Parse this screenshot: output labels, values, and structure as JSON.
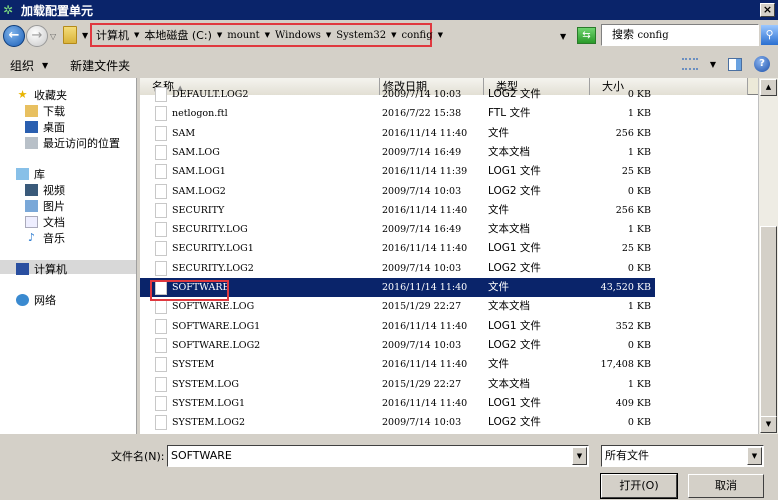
{
  "window": {
    "title": "加载配置单元",
    "close_label": "×"
  },
  "navigation": {
    "breadcrumbs": [
      "计算机",
      "本地磁盘 (C:)",
      "mount",
      "Windows",
      "System32",
      "config"
    ],
    "search_placeholder_prefix": "搜索",
    "search_scope": "config"
  },
  "toolbar": {
    "organize": "组织",
    "new_folder": "新建文件夹"
  },
  "sidebar": {
    "favorites": {
      "label": "收藏夹",
      "items": [
        "下载",
        "桌面",
        "最近访问的位置"
      ]
    },
    "libraries": {
      "label": "库",
      "items": [
        "视频",
        "图片",
        "文档",
        "音乐"
      ]
    },
    "computer": "计算机",
    "network": "网络"
  },
  "columns": {
    "name": "名称",
    "date": "修改日期",
    "type": "类型",
    "size": "大小"
  },
  "files": [
    {
      "name": "DEFAULT.LOG2",
      "date": "2009/7/14 10:03",
      "type": "LOG2 文件",
      "size": "0 KB"
    },
    {
      "name": "netlogon.ftl",
      "date": "2016/7/22 15:38",
      "type": "FTL 文件",
      "size": "1 KB"
    },
    {
      "name": "SAM",
      "date": "2016/11/14 11:40",
      "type": "文件",
      "size": "256 KB"
    },
    {
      "name": "SAM.LOG",
      "date": "2009/7/14 16:49",
      "type": "文本文档",
      "size": "1 KB"
    },
    {
      "name": "SAM.LOG1",
      "date": "2016/11/14 11:39",
      "type": "LOG1 文件",
      "size": "25 KB"
    },
    {
      "name": "SAM.LOG2",
      "date": "2009/7/14 10:03",
      "type": "LOG2 文件",
      "size": "0 KB"
    },
    {
      "name": "SECURITY",
      "date": "2016/11/14 11:40",
      "type": "文件",
      "size": "256 KB"
    },
    {
      "name": "SECURITY.LOG",
      "date": "2009/7/14 16:49",
      "type": "文本文档",
      "size": "1 KB"
    },
    {
      "name": "SECURITY.LOG1",
      "date": "2016/11/14 11:40",
      "type": "LOG1 文件",
      "size": "25 KB"
    },
    {
      "name": "SECURITY.LOG2",
      "date": "2009/7/14 10:03",
      "type": "LOG2 文件",
      "size": "0 KB"
    },
    {
      "name": "SOFTWARE",
      "date": "2016/11/14 11:40",
      "type": "文件",
      "size": "43,520 KB",
      "selected": true
    },
    {
      "name": "SOFTWARE.LOG",
      "date": "2015/1/29 22:27",
      "type": "文本文档",
      "size": "1 KB"
    },
    {
      "name": "SOFTWARE.LOG1",
      "date": "2016/11/14 11:40",
      "type": "LOG1 文件",
      "size": "352 KB"
    },
    {
      "name": "SOFTWARE.LOG2",
      "date": "2009/7/14 10:03",
      "type": "LOG2 文件",
      "size": "0 KB"
    },
    {
      "name": "SYSTEM",
      "date": "2016/11/14 11:40",
      "type": "文件",
      "size": "17,408 KB"
    },
    {
      "name": "SYSTEM.LOG",
      "date": "2015/1/29 22:27",
      "type": "文本文档",
      "size": "1 KB"
    },
    {
      "name": "SYSTEM.LOG1",
      "date": "2016/11/14 11:40",
      "type": "LOG1 文件",
      "size": "409 KB"
    },
    {
      "name": "SYSTEM.LOG2",
      "date": "2009/7/14 10:03",
      "type": "LOG2 文件",
      "size": "0 KB"
    }
  ],
  "footer": {
    "filename_label": "文件名(N):",
    "filename_value": "SOFTWARE",
    "filetype_value": "所有文件",
    "open_label": "打开(O)",
    "cancel_label": "取消"
  },
  "colors": {
    "titlebar": "#0a246a",
    "selection": "#0a246a",
    "highlight_box": "#e0383f"
  }
}
